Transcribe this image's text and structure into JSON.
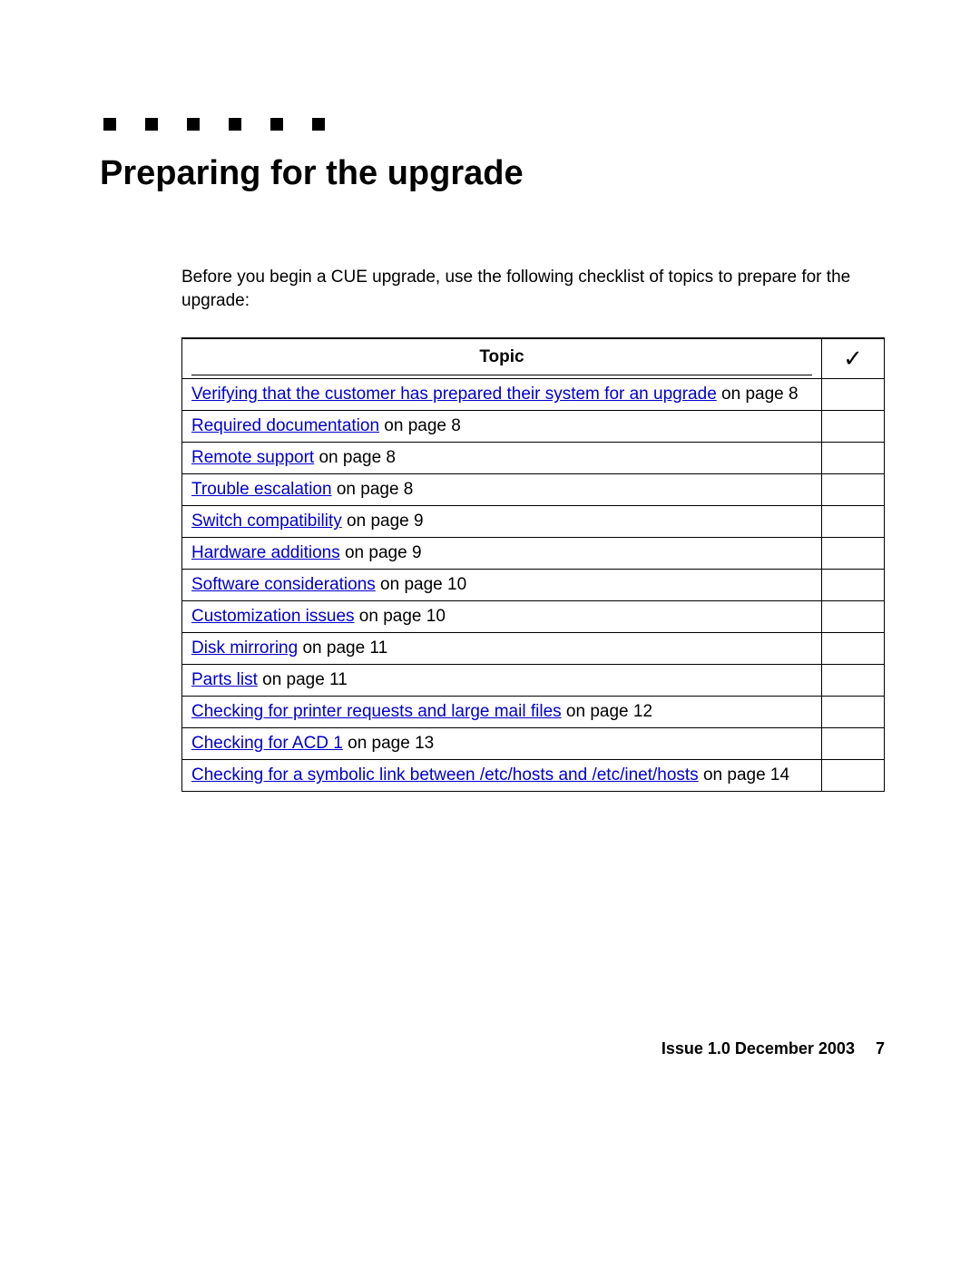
{
  "title": "Preparing for the upgrade",
  "intro": "Before you begin a CUE upgrade, use the following checklist of topics to prepare for the upgrade:",
  "table": {
    "header_topic": "Topic",
    "header_check": "✓",
    "rows": [
      {
        "link": "Verifying that the customer has prepared their system for an upgrade",
        "suffix": " on page 8"
      },
      {
        "link": "Required documentation",
        "suffix": " on page 8"
      },
      {
        "link": "Remote support",
        "suffix": " on page 8"
      },
      {
        "link": "Trouble escalation",
        "suffix": " on page 8"
      },
      {
        "link": "Switch compatibility",
        "suffix": " on page 9"
      },
      {
        "link": "Hardware additions",
        "suffix": " on page 9"
      },
      {
        "link": "Software considerations",
        "suffix": " on page 10"
      },
      {
        "link": "Customization issues",
        "suffix": " on page 10"
      },
      {
        "link": "Disk mirroring",
        "suffix": " on page 11"
      },
      {
        "link": "Parts list",
        "suffix": " on page 11"
      },
      {
        "link": "Checking for printer requests and large mail files",
        "suffix": " on page 12"
      },
      {
        "link": "Checking for ACD 1",
        "suffix": " on page 13"
      },
      {
        "link": "Checking for a symbolic link between /etc/hosts and /etc/inet/hosts",
        "suffix": " on page 14"
      }
    ]
  },
  "footer": {
    "issue": "Issue 1.0   December 2003",
    "page": "7"
  }
}
